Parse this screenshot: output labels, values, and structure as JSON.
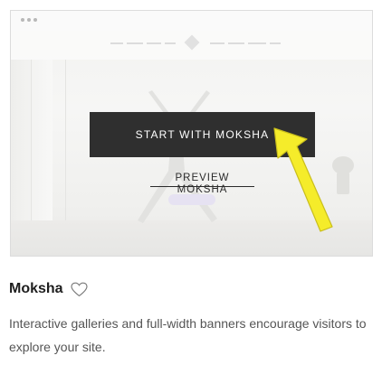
{
  "template": {
    "name": "Moksha",
    "description": "Interactive galleries and full-width banners encourage visitors to explore your site.",
    "start_label": "START WITH MOKSHA",
    "preview_label": "PREVIEW MOKSHA"
  },
  "icons": {
    "favorite": "heart-outline-icon",
    "annotation": "yellow-arrow-icon"
  },
  "colors": {
    "start_button_bg": "#2f2f2f",
    "arrow": "#f5ec2a",
    "text_primary": "#1e1e1e",
    "text_secondary": "#555555"
  }
}
